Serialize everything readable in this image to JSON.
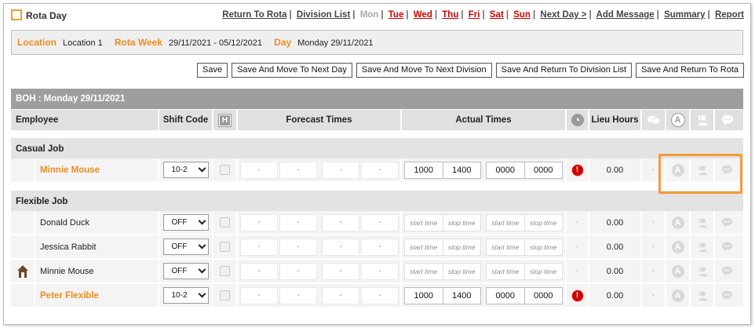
{
  "title": "Rota Day",
  "nav": {
    "return_to_rota": "Return To Rota",
    "division_list": "Division List",
    "days": [
      "Mon",
      "Tue",
      "Wed",
      "Thu",
      "Fri",
      "Sat",
      "Sun"
    ],
    "current_day": "Mon",
    "next_day": "Next Day >",
    "add_message": "Add Message",
    "summary": "Summary",
    "report": "Report"
  },
  "info": {
    "location_label": "Location",
    "location_value": "Location 1",
    "rota_week_label": "Rota Week",
    "rota_week_value": "29/11/2021 - 05/12/2021",
    "day_label": "Day",
    "day_value": "Monday 29/11/2021"
  },
  "actions": [
    "Save",
    "Save And Move To Next Day",
    "Save And Move To Next Division",
    "Save And Return To Division List",
    "Save And Return To Rota"
  ],
  "division_title": "BOH : Monday 29/11/2021",
  "columns": {
    "employee": "Employee",
    "shift_code": "Shift Code",
    "h": "H",
    "forecast": "Forecast Times",
    "actual": "Actual Times",
    "lieu": "Lieu Hours"
  },
  "sections": [
    {
      "title": "Casual Job",
      "rows": [
        {
          "name": "Minnie Mouse",
          "highlight": true,
          "shift": "10-2",
          "actual": [
            "1000",
            "1400",
            "0000",
            "0000"
          ],
          "alert": true,
          "lieu": "0.00"
        }
      ]
    },
    {
      "title": "Flexible Job",
      "rows": [
        {
          "name": "Donald Duck",
          "highlight": false,
          "shift": "OFF",
          "actual": null,
          "alert": false,
          "lieu": "0.00"
        },
        {
          "name": "Jessica Rabbit",
          "highlight": false,
          "shift": "OFF",
          "actual": null,
          "alert": false,
          "lieu": "0.00"
        },
        {
          "name": "Minnie Mouse",
          "highlight": false,
          "shift": "OFF",
          "actual": null,
          "alert": false,
          "lieu": "0.00",
          "has_icon": true
        },
        {
          "name": "Peter Flexible",
          "highlight": true,
          "shift": "10-2",
          "actual": [
            "1000",
            "1400",
            "0000",
            "0000"
          ],
          "alert": true,
          "lieu": "0.00"
        }
      ]
    }
  ],
  "forecast_placeholder": "-",
  "placeholders": {
    "start": "start time",
    "stop": "stop time"
  },
  "alert_glyph": "!",
  "colors": {
    "accent": "#f08c1e",
    "day_link": "#d00000",
    "alert": "#cc0000",
    "header_dark": "#9e9e9e"
  }
}
